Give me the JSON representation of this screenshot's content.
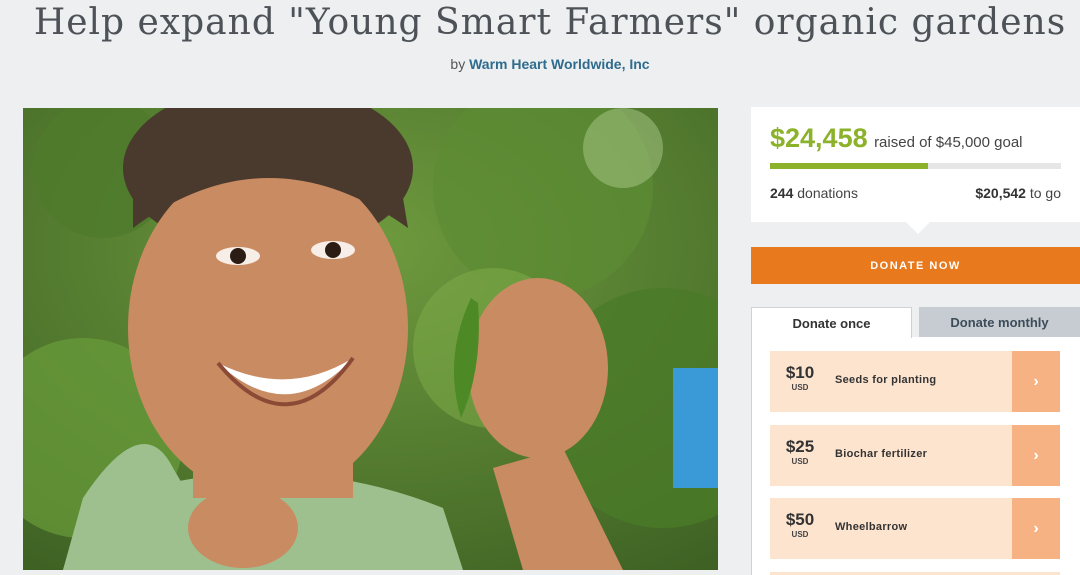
{
  "header": {
    "title": "Help expand \"Young Smart Farmers\" organic gardens",
    "by_prefix": "by",
    "organization": "Warm Heart Worldwide, Inc"
  },
  "funding": {
    "raised": "$24,458",
    "goal_text": "raised of $45,000 goal",
    "progress_fraction": 0.5435,
    "donations_count": "244",
    "donations_label": "donations",
    "remaining": "$20,542",
    "remaining_label": "to go"
  },
  "donate_now_label": "DONATE NOW",
  "tabs": {
    "once": "Donate once",
    "monthly": "Donate monthly"
  },
  "options": [
    {
      "amount": "$10",
      "currency": "USD",
      "label": "Seeds for planting",
      "arrow": "›"
    },
    {
      "amount": "$25",
      "currency": "USD",
      "label": "Biochar fertilizer",
      "arrow": "›"
    },
    {
      "amount": "$50",
      "currency": "USD",
      "label": "Wheelbarrow",
      "arrow": "›"
    }
  ],
  "colors": {
    "accent_green": "#8cb22b",
    "donate_orange": "#e8791c",
    "option_bg": "#fde4cf",
    "option_arrow": "#f6b282",
    "link_blue": "#2f6b8d"
  }
}
